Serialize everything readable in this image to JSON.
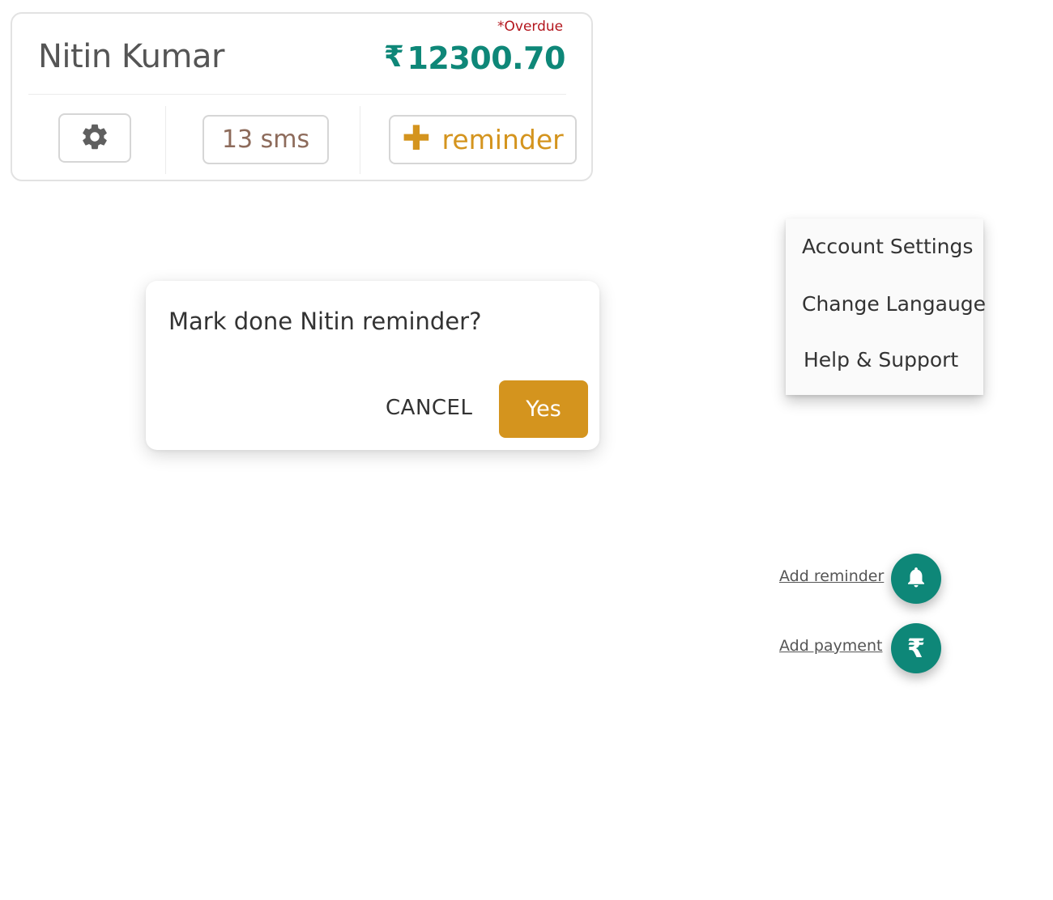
{
  "card": {
    "overdue_label": "*Overdue",
    "customer_name": "Nitin Kumar",
    "currency_symbol": "₹",
    "amount": "12300.70",
    "sms_label": "13 sms",
    "reminder_label": "reminder",
    "plus_glyph": "✚"
  },
  "dialog": {
    "message": "Mark done Nitin reminder?",
    "cancel_label": "CANCEL",
    "confirm_label": "Yes"
  },
  "menu": {
    "items": [
      {
        "label": "Account Settings"
      },
      {
        "label": "Change Langauge"
      },
      {
        "label": "Help & Support"
      }
    ]
  },
  "fab": {
    "add_reminder_label": "Add reminder",
    "add_payment_label": "Add payment",
    "rupee_glyph": "₹"
  },
  "icons": {
    "settings": "gear-icon",
    "bell": "bell-icon",
    "rupee": "rupee-icon"
  },
  "colors": {
    "teal": "#0e8778",
    "gold": "#d4941e",
    "overdue_red": "#b3151c",
    "sms_brown": "#8d6b5b"
  }
}
